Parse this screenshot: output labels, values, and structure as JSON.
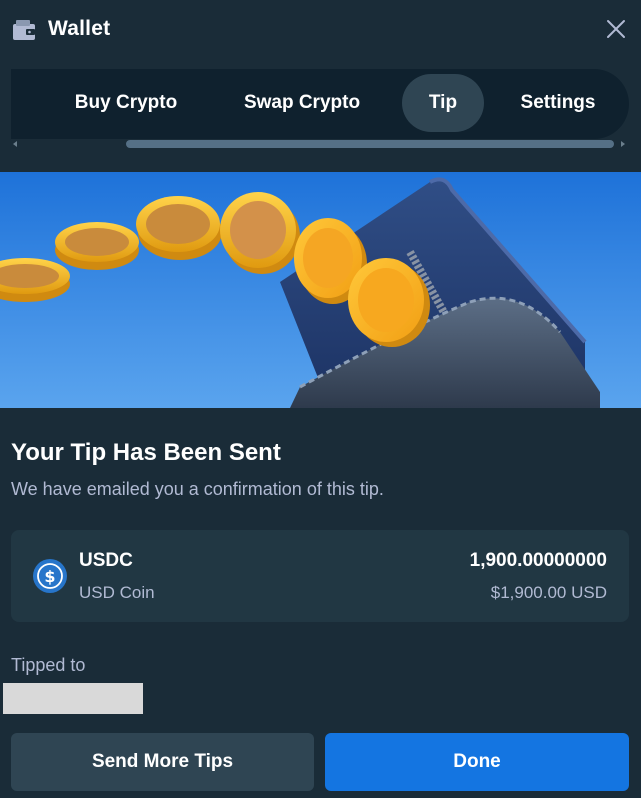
{
  "header": {
    "title": "Wallet",
    "wallet_icon": "wallet-icon",
    "close_icon": "close-icon"
  },
  "tabs": [
    {
      "label": "Buy Crypto",
      "active": false
    },
    {
      "label": "Swap Crypto",
      "active": false
    },
    {
      "label": "Tip",
      "active": true
    },
    {
      "label": "Settings",
      "active": false
    }
  ],
  "banner": {
    "image": "coins-flying-into-wallet-illustration"
  },
  "confirmation": {
    "title": "Your Tip Has Been Sent",
    "subtitle": "We have emailed you a confirmation of this tip."
  },
  "coin": {
    "symbol": "USDC",
    "name": "USD Coin",
    "amount": "1,900.00000000",
    "usd_value": "$1,900.00 USD",
    "icon": "usdc-icon",
    "color": "#2775ca"
  },
  "tipped": {
    "label": "Tipped to"
  },
  "actions": {
    "send_more_label": "Send More Tips",
    "done_label": "Done"
  },
  "colors": {
    "background": "#1a2c38",
    "card": "#213743",
    "tabs_bg": "#0f212e",
    "active_tab": "#2f4553",
    "primary": "#1475e1",
    "muted_text": "#b1bad3"
  }
}
